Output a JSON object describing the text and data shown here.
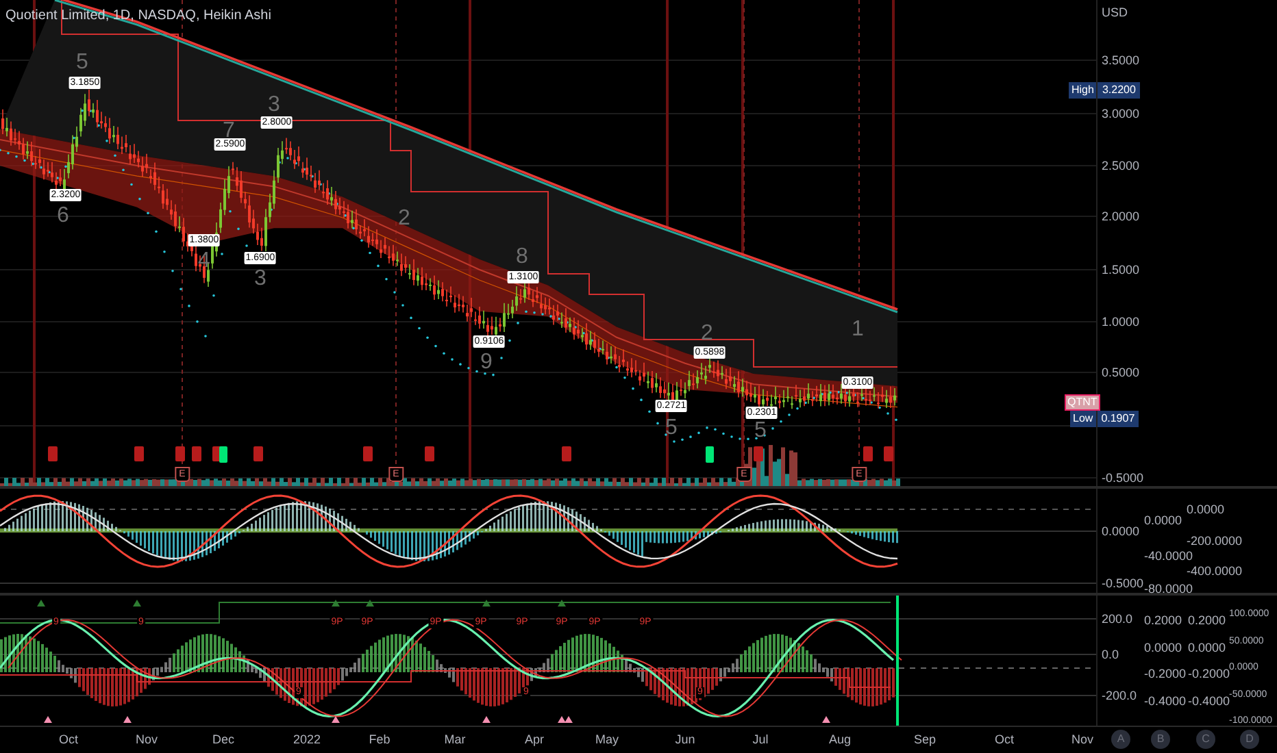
{
  "header": {
    "title": "Quotient Limited, 1D, NASDAQ, Heikin Ashi"
  },
  "price_pane": {
    "currency": "USD",
    "axis_labels": [
      "3.5000",
      "3.0000",
      "2.5000",
      "2.0000",
      "1.5000",
      "1.0000",
      "0.5000",
      "-0.5000"
    ],
    "high_label": {
      "label": "High",
      "value": "3.2200"
    },
    "symbol_badge": "QTNT",
    "low_label": {
      "label": "Low",
      "value": "0.1907"
    },
    "annotations": [
      {
        "text": "5",
        "kind": "wave"
      },
      {
        "text": "3.1850",
        "kind": "price"
      },
      {
        "text": "3",
        "kind": "wave"
      },
      {
        "text": "2.8000",
        "kind": "price"
      },
      {
        "text": "7",
        "kind": "wave"
      },
      {
        "text": "2.5900",
        "kind": "price"
      },
      {
        "text": "2.3200",
        "kind": "price"
      },
      {
        "text": "6",
        "kind": "wave"
      },
      {
        "text": "1.3800",
        "kind": "price"
      },
      {
        "text": "4",
        "kind": "wave"
      },
      {
        "text": "1.6900",
        "kind": "price"
      },
      {
        "text": "3",
        "kind": "wave"
      },
      {
        "text": "2",
        "kind": "wave"
      },
      {
        "text": "8",
        "kind": "wave"
      },
      {
        "text": "1.3100",
        "kind": "price"
      },
      {
        "text": "0.9106",
        "kind": "price"
      },
      {
        "text": "9",
        "kind": "wave"
      },
      {
        "text": "2",
        "kind": "wave"
      },
      {
        "text": "0.5898",
        "kind": "price"
      },
      {
        "text": "1",
        "kind": "wave"
      },
      {
        "text": "0.3100",
        "kind": "price"
      },
      {
        "text": "0.2721",
        "kind": "price"
      },
      {
        "text": "5",
        "kind": "wave"
      },
      {
        "text": "0.2301",
        "kind": "price"
      },
      {
        "text": "5",
        "kind": "wave"
      }
    ],
    "earnings_markers": [
      "E",
      "E",
      "E",
      "E"
    ]
  },
  "oscillator_pane": {
    "scale_a": [
      "0.0000",
      "-0.5000"
    ],
    "scale_b": [
      "0.0000",
      "-40.0000",
      "-80.0000"
    ],
    "scale_c": [
      "0.0000",
      "-200.0000",
      "-400.0000"
    ]
  },
  "signal_pane": {
    "markers": [
      "9",
      "9",
      "9P",
      "9P",
      "9P",
      "9P",
      "9P",
      "9P",
      "9P",
      "9P",
      "9",
      "9",
      "9"
    ],
    "scale_a": [
      "200.0",
      "0.0",
      "-200.0"
    ],
    "scale_b": [
      "0.2000",
      "0.0000",
      "-0.2000",
      "-0.4000"
    ],
    "scale_c": [
      "0.2000",
      "0.0000",
      "-0.2000",
      "-0.4000"
    ],
    "scale_d": [
      "100.0000",
      "50.0000",
      "0.0000",
      "-50.0000",
      "-100.0000"
    ]
  },
  "time_axis": {
    "labels": [
      "Oct",
      "Nov",
      "Dec",
      "2022",
      "Feb",
      "Mar",
      "Apr",
      "May",
      "Jun",
      "Jul",
      "Aug",
      "Sep",
      "Oct",
      "Nov"
    ]
  },
  "scale_buttons": [
    "A",
    "B",
    "C",
    "D"
  ]
}
